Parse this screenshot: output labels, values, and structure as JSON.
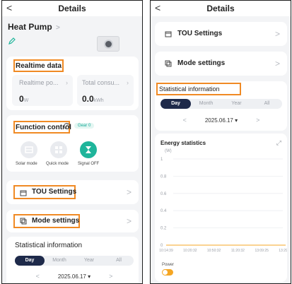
{
  "left": {
    "nav": {
      "back": "<",
      "title": "Details"
    },
    "device": {
      "name": "Heat Pump",
      "chevron": ">"
    },
    "realtime": {
      "title": "Realtime data",
      "power": {
        "label": "Realtime po...",
        "value": "0",
        "unit": "W"
      },
      "consumption": {
        "label": "Total consu...",
        "value": "0.0",
        "unit": "kWh"
      }
    },
    "function_control": {
      "title": "Function control",
      "gear_badge": "Gear 0",
      "buttons": [
        {
          "label": "Solar mode",
          "icon": "solar-mode-icon"
        },
        {
          "label": "Quick mode",
          "icon": "quick-mode-icon"
        },
        {
          "label": "Signal OFF",
          "icon": "signal-icon"
        }
      ]
    },
    "tou": {
      "label": "TOU Settings",
      "chevron": ">"
    },
    "mode": {
      "label": "Mode settings",
      "chevron": ">"
    },
    "stats": {
      "title": "Statistical information",
      "tabs": [
        "Day",
        "Month",
        "Year",
        "All"
      ],
      "active_tab": "Day",
      "date": "2025.06.17",
      "prev": "<",
      "next": ">"
    }
  },
  "right": {
    "nav": {
      "back": "<",
      "title": "Details"
    },
    "tou": {
      "label": "TOU Settings",
      "chevron": ">"
    },
    "mode": {
      "label": "Mode settings",
      "chevron": ">"
    },
    "stats": {
      "title": "Statistical information",
      "tabs": [
        "Day",
        "Month",
        "Year",
        "All"
      ],
      "active_tab": "Day",
      "date": "2025.06.17",
      "prev": "<",
      "next": ">"
    },
    "energy": {
      "title": "Energy statistics",
      "unit": "(W)",
      "legend_label": "Power",
      "toggle_on": true
    }
  },
  "colors": {
    "accent_orange": "#f08a24",
    "tab_active": "#1e2a4a",
    "teal": "#1fb59b",
    "badge_teal": "#13a896"
  },
  "chart_data": {
    "type": "line",
    "title": "Energy statistics",
    "ylabel": "(W)",
    "ylim": [
      0,
      1
    ],
    "yticks": [
      "0",
      "0.2",
      "0.4",
      "0.6",
      "0.8",
      "1"
    ],
    "x": [
      "10:14:39",
      "10:20:32",
      "10:50:32",
      "11:20:32",
      "13:09:25",
      "13:29:27"
    ],
    "series": [
      {
        "name": "Power",
        "values": [
          0,
          0,
          0,
          0,
          0,
          0
        ]
      }
    ],
    "grid": true,
    "legend": "bottom-left"
  }
}
